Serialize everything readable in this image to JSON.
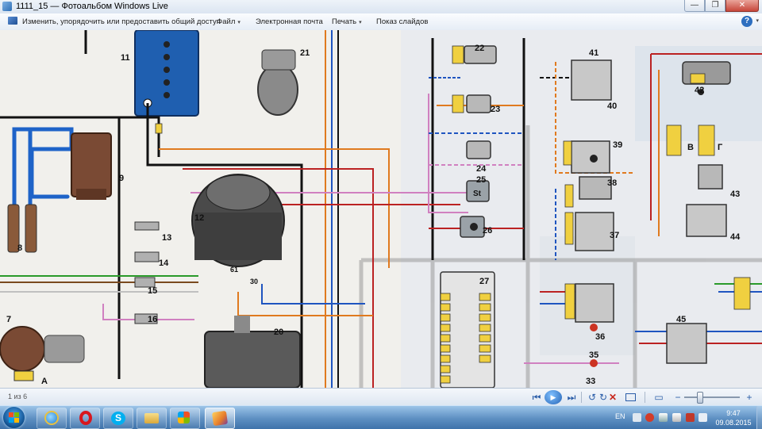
{
  "window": {
    "title": "1111_15 — Фотоальбом Windows Live",
    "controls": {
      "minimize": "—",
      "maximize": "❐",
      "close": "✕"
    }
  },
  "commandbar": {
    "items": [
      {
        "label": "Изменить, упорядочить или предоставить общий доступ",
        "has_menu": false,
        "icon": "edit-icon"
      },
      {
        "label": "Файл",
        "has_menu": true
      },
      {
        "label": "Электронная почта",
        "has_menu": false
      },
      {
        "label": "Печать",
        "has_menu": true
      },
      {
        "label": "Показ слайдов",
        "has_menu": false
      }
    ],
    "help": "?",
    "menu_arrow": "▾"
  },
  "image": {
    "component_labels": [
      "7",
      "8",
      "9",
      "11",
      "12",
      "13",
      "14",
      "15",
      "16",
      "20",
      "21",
      "22",
      "23",
      "24",
      "25",
      "26",
      "27",
      "33",
      "35",
      "36",
      "37",
      "38",
      "39",
      "40",
      "41",
      "42",
      "43",
      "44",
      "45",
      "61",
      "30",
      "В",
      "Г",
      "St",
      "A"
    ]
  },
  "statusbar": {
    "page_count": "1 из 6"
  },
  "controls": {
    "prev_icon": "⏮",
    "slideshow_icon": "▶",
    "next_icon": "⏭",
    "rotate_left_icon": "↺",
    "rotate_right_icon": "↻",
    "delete_icon": "✕",
    "fit_icon": "▭",
    "zoom_out_icon": "−",
    "zoom_in_icon": "+",
    "zoom_level": 0.23
  },
  "taskbar": {
    "apps": [
      {
        "name": "internet-explorer",
        "active": false
      },
      {
        "name": "opera",
        "active": false
      },
      {
        "name": "skype",
        "active": false
      },
      {
        "name": "explorer",
        "active": false
      },
      {
        "name": "windows-live-app",
        "active": false
      },
      {
        "name": "photo-gallery",
        "active": true
      }
    ],
    "language": "EN",
    "time": "9:47",
    "date": "09.08.2015"
  },
  "colors": {
    "accent": "#2d6fc0",
    "taskbar": "#5d8fc2",
    "close": "#c7463a"
  }
}
